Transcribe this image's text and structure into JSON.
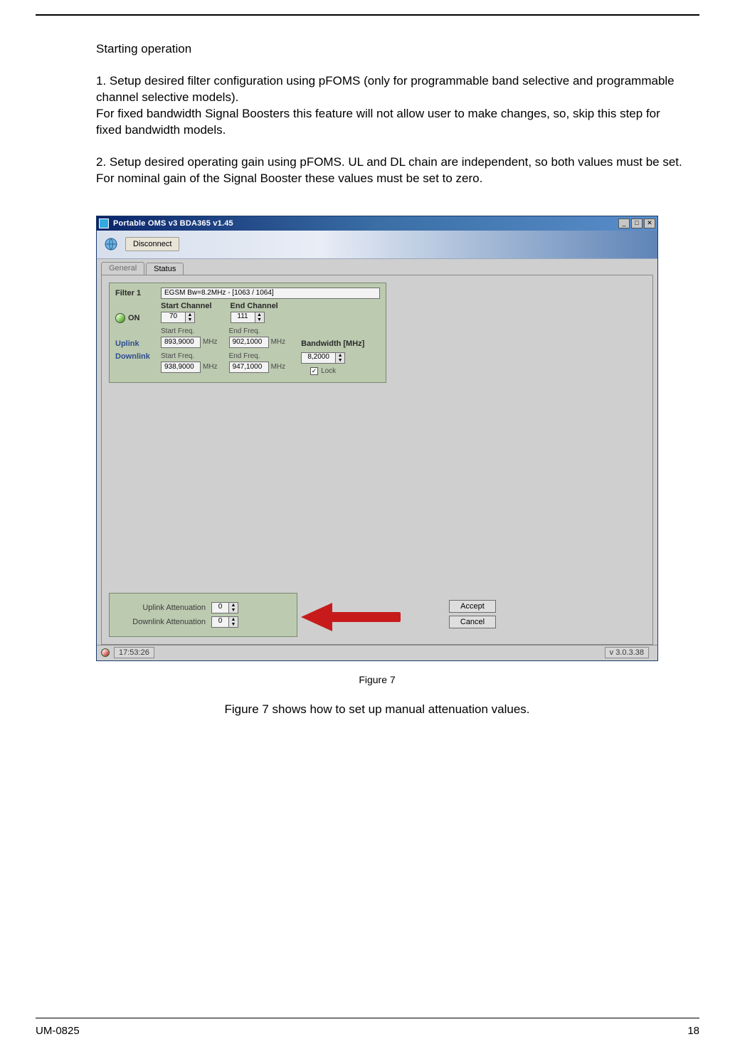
{
  "heading": "Starting operation",
  "para1": "1. Setup desired filter configuration using pFOMS (only for programmable band selective and programmable channel selective models).",
  "para1b": "For fixed bandwidth Signal Boosters this feature will not allow user to make changes, so, skip this step for fixed bandwidth models.",
  "para2": "2. Setup desired operating gain using pFOMS. UL and DL chain are independent, so both values must be set.",
  "para2b": "For nominal gain of the Signal Booster these values must be set to zero.",
  "app": {
    "title": "Portable OMS v3  BDA365 v1.45",
    "disconnect": "Disconnect",
    "tabs": {
      "general": "General",
      "status": "Status"
    },
    "filter": {
      "title": "Filter 1",
      "summary": "EGSM Bw=8.2MHz - [1063 / 1064]",
      "on": "ON",
      "start_channel_lbl": "Start Channel",
      "start_channel": "70",
      "end_channel_lbl": "End Channel",
      "end_channel": "111",
      "uplink": "Uplink",
      "downlink": "Downlink",
      "start_freq_lbl": "Start Freq.",
      "end_freq_lbl": "End Freq.",
      "ul_start": "893,9000",
      "ul_end": "902,1000",
      "dl_start": "938,9000",
      "dl_end": "947,1000",
      "mhz": "MHz",
      "bw_lbl": "Bandwidth [MHz]",
      "bw": "8,2000",
      "lock": "Lock"
    },
    "atten": {
      "ul_lbl": "Uplink Attenuation",
      "dl_lbl": "Downlink Attenuation",
      "ul": "0",
      "dl": "0"
    },
    "buttons": {
      "accept": "Accept",
      "cancel": "Cancel"
    },
    "status": {
      "time": "17:53:26",
      "ver": "v 3.0.3.38"
    }
  },
  "figure_caption": "Figure 7",
  "figure_desc": "Figure 7 shows how to set up manual attenuation values.",
  "footer_left": "UM-0825",
  "footer_right": "18"
}
